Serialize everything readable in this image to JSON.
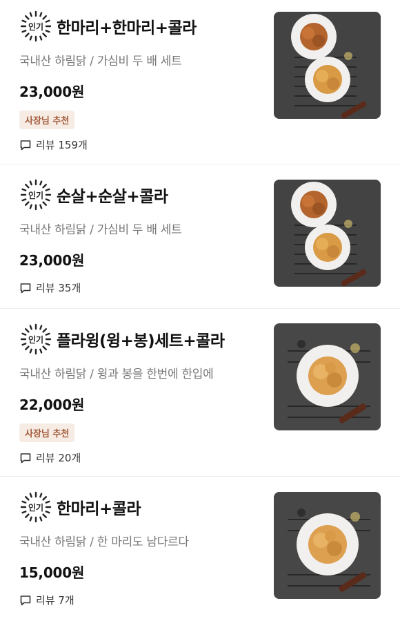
{
  "menu_items": [
    {
      "title": "한마리+한마리+콜라",
      "badge": "인기",
      "description": "국내산 하림닭 / 가심비 두 배 세트",
      "price": "23,000원",
      "recommendation": "사장님 추천",
      "review": "리뷰 159개"
    },
    {
      "title": "순살+순살+콜라",
      "badge": "인기",
      "description": "국내산 하림닭 / 가심비 두 배 세트",
      "price": "23,000원",
      "review": "리뷰 35개"
    },
    {
      "title": "플라윙(윙+봉)세트+콜라",
      "badge": "인기",
      "description": "국내산 하림닭 / 윙과 봉을 한번에 한입에",
      "price": "22,000원",
      "recommendation": "사장님 추천",
      "review": "리뷰 20개"
    },
    {
      "title": "한마리+콜라",
      "badge": "인기",
      "description": "국내산 하림닭 / 한 마리도 남다르다",
      "price": "15,000원",
      "review": "리뷰 7개"
    }
  ],
  "colors": {
    "recommend_bg": "#f6ece4",
    "recommend_text": "#a35a3a",
    "description_text": "#777777"
  }
}
